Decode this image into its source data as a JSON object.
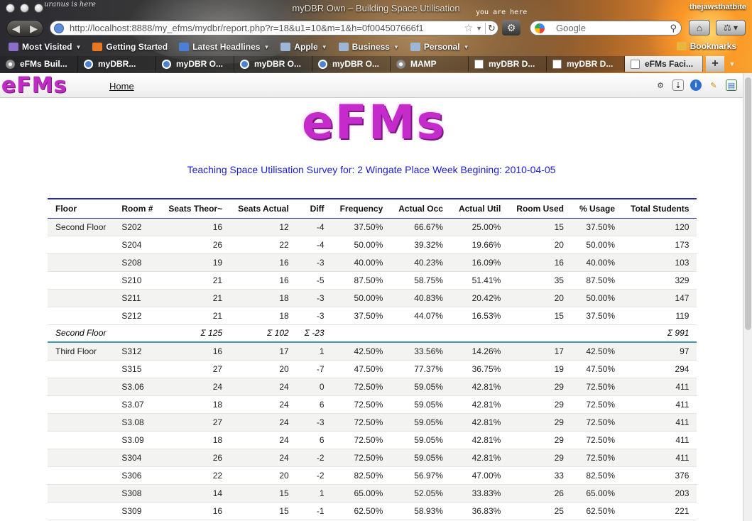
{
  "browser": {
    "window_title": "myDBR Own – Building Space Utilisation",
    "user_tag": "thejawsthatbite",
    "doodle": "uranus is here",
    "annotation": "you are here",
    "url": "http://localhost:8888/my_efms/mydbr/report.php?r=18&u1=10&m=1&h=0f004507666f1",
    "search_placeholder": "Google",
    "bookmarks": [
      {
        "label": "Most Visited",
        "icon": "most-visited-icon",
        "color": "#8a6fc9",
        "caret": true
      },
      {
        "label": "Getting Started",
        "icon": "firefox-icon",
        "color": "#e87722",
        "caret": false
      },
      {
        "label": "Latest Headlines",
        "icon": "rss-icon",
        "color": "#4a7fd4",
        "caret": true
      },
      {
        "label": "Apple",
        "icon": "folder-icon",
        "color": "#9cb6d6",
        "caret": true
      },
      {
        "label": "Business",
        "icon": "folder-icon",
        "color": "#9cb6d6",
        "caret": true
      },
      {
        "label": "Personal",
        "icon": "folder-icon",
        "color": "#9cb6d6",
        "caret": true
      }
    ],
    "bookmarks_menu": "Bookmarks",
    "tabs": [
      {
        "label": "eFMs Buil...",
        "icon": "gear",
        "active": false
      },
      {
        "label": "myDBR...",
        "icon": "page",
        "active": false
      },
      {
        "label": "myDBR O...",
        "icon": "page",
        "active": false
      },
      {
        "label": "myDBR O...",
        "icon": "page",
        "active": false
      },
      {
        "label": "myDBR O...",
        "icon": "page",
        "active": false
      },
      {
        "label": "MAMP",
        "icon": "gear",
        "active": false
      },
      {
        "label": "myDBR D...",
        "icon": "doc",
        "active": false
      },
      {
        "label": "myDBR D...",
        "icon": "doc",
        "active": false
      },
      {
        "label": "eFMs Faci...",
        "icon": "doc",
        "active": true
      }
    ]
  },
  "app": {
    "logo_small": "eFMs",
    "home_link": "Home",
    "logo_big": "eFMs"
  },
  "report": {
    "title": "Teaching Space Utilisation Survey for: 2 Wingate Place Week Begining: 2010-04-05",
    "columns": [
      "Floor",
      "Room #",
      "Seats Theor~",
      "Seats Actual",
      "Diff",
      "Frequency",
      "Actual Occ",
      "Actual Util",
      "Room Used",
      "% Usage",
      "Total Students"
    ],
    "rows": [
      {
        "kind": "row",
        "cells": [
          "Second Floor",
          "S202",
          "16",
          "12",
          "-4",
          "37.50%",
          "66.67%",
          "25.00%",
          "15",
          "37.50%",
          "120"
        ]
      },
      {
        "kind": "row",
        "cells": [
          "",
          "S204",
          "26",
          "22",
          "-4",
          "50.00%",
          "39.32%",
          "19.66%",
          "20",
          "50.00%",
          "173"
        ]
      },
      {
        "kind": "row",
        "cells": [
          "",
          "S208",
          "19",
          "16",
          "-3",
          "40.00%",
          "40.23%",
          "16.09%",
          "16",
          "40.00%",
          "103"
        ]
      },
      {
        "kind": "row",
        "cells": [
          "",
          "S210",
          "21",
          "16",
          "-5",
          "87.50%",
          "58.75%",
          "51.41%",
          "35",
          "87.50%",
          "329"
        ]
      },
      {
        "kind": "row",
        "cells": [
          "",
          "S211",
          "21",
          "18",
          "-3",
          "50.00%",
          "40.83%",
          "20.42%",
          "20",
          "50.00%",
          "147"
        ]
      },
      {
        "kind": "row",
        "cells": [
          "",
          "S212",
          "21",
          "18",
          "-3",
          "37.50%",
          "44.07%",
          "16.53%",
          "15",
          "37.50%",
          "119"
        ]
      },
      {
        "kind": "subtotal",
        "cells": [
          "Second Floor",
          "",
          "Σ 125",
          "Σ 102",
          "Σ -23",
          "",
          "",
          "",
          "",
          "",
          "Σ 991"
        ]
      },
      {
        "kind": "row",
        "cells": [
          "Third Floor",
          "S312",
          "16",
          "17",
          "1",
          "42.50%",
          "33.56%",
          "14.26%",
          "17",
          "42.50%",
          "97"
        ]
      },
      {
        "kind": "row",
        "cells": [
          "",
          "S315",
          "27",
          "20",
          "-7",
          "47.50%",
          "77.37%",
          "36.75%",
          "19",
          "47.50%",
          "294"
        ]
      },
      {
        "kind": "row",
        "cells": [
          "",
          "S3.06",
          "24",
          "24",
          "0",
          "72.50%",
          "59.05%",
          "42.81%",
          "29",
          "72.50%",
          "411"
        ]
      },
      {
        "kind": "row",
        "cells": [
          "",
          "S3.07",
          "18",
          "24",
          "6",
          "72.50%",
          "59.05%",
          "42.81%",
          "29",
          "72.50%",
          "411"
        ]
      },
      {
        "kind": "row",
        "cells": [
          "",
          "S3.08",
          "27",
          "24",
          "-3",
          "72.50%",
          "59.05%",
          "42.81%",
          "29",
          "72.50%",
          "411"
        ]
      },
      {
        "kind": "row",
        "cells": [
          "",
          "S3.09",
          "18",
          "24",
          "6",
          "72.50%",
          "59.05%",
          "42.81%",
          "29",
          "72.50%",
          "411"
        ]
      },
      {
        "kind": "row",
        "cells": [
          "",
          "S304",
          "26",
          "24",
          "-2",
          "72.50%",
          "59.05%",
          "42.81%",
          "29",
          "72.50%",
          "411"
        ]
      },
      {
        "kind": "row",
        "cells": [
          "",
          "S306",
          "22",
          "20",
          "-2",
          "82.50%",
          "56.97%",
          "47.00%",
          "33",
          "82.50%",
          "376"
        ]
      },
      {
        "kind": "row",
        "cells": [
          "",
          "S308",
          "14",
          "15",
          "1",
          "65.00%",
          "52.05%",
          "33.83%",
          "26",
          "65.00%",
          "203"
        ]
      },
      {
        "kind": "row",
        "cells": [
          "",
          "S309",
          "16",
          "15",
          "-1",
          "62.50%",
          "58.93%",
          "36.83%",
          "25",
          "62.50%",
          "221"
        ]
      }
    ]
  }
}
